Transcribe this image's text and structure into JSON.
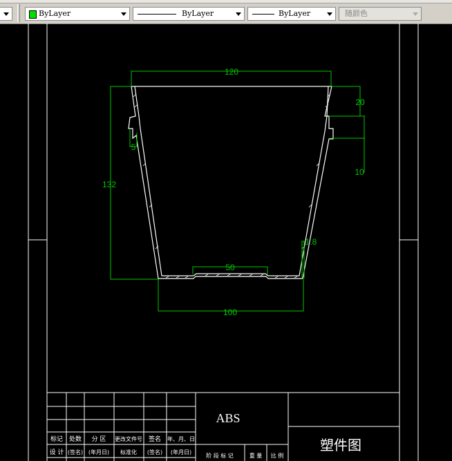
{
  "toolbar": {
    "color_value": "ByLayer",
    "linetype_value": "ByLayer",
    "lineweight_value": "ByLayer",
    "plotstyle_value": "随颜色",
    "colors": {
      "swatch": "#00e000"
    }
  },
  "drawing": {
    "dims": {
      "top_width": "120",
      "height": "132",
      "rim_depth": "20",
      "groove_height": "10",
      "hook_width": "5",
      "wall_thickness": "1.8",
      "bottom_recess": "50",
      "bottom_width": "100"
    },
    "colors": {
      "geometry": "#ffffff",
      "dimension": "#00c800"
    }
  },
  "title_block": {
    "material": "ABS",
    "drawing_title": "塑件图",
    "row_headers": [
      "标记",
      "处数",
      "分 区",
      "更改文件号",
      "签名",
      "年、月、日"
    ],
    "design_row": [
      "设 计",
      "(签名)",
      "(年月日)",
      "标准化",
      "(签名)",
      "(年月日)"
    ],
    "phase_row": [
      "阶 段 标 记",
      "重 量",
      "比 例"
    ]
  }
}
